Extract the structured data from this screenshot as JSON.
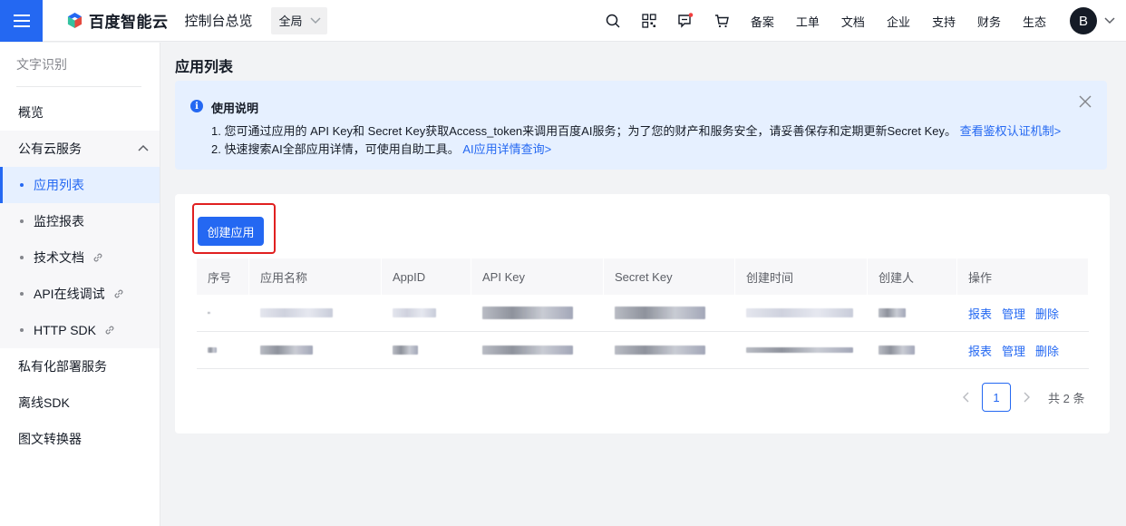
{
  "topbar": {
    "brand": "百度智能云",
    "console_title": "控制台总览",
    "region": "全局",
    "nav": [
      "备案",
      "工单",
      "文档",
      "企业",
      "支持",
      "财务",
      "生态"
    ],
    "avatar_letter": "B",
    "icons": [
      "search-icon",
      "qrcode-icon",
      "message-icon",
      "cart-icon"
    ],
    "accent": "#2468f2"
  },
  "sidebar": {
    "header": "文字识别",
    "overview": "概览",
    "public_group": "公有云服务",
    "sub_items": [
      "应用列表",
      "监控报表",
      "技术文档",
      "API在线调试",
      "HTTP SDK"
    ],
    "private_deploy": "私有化部署服务",
    "offline_sdk": "离线SDK",
    "converter": "图文转换器"
  },
  "main": {
    "title": "应用列表",
    "notice": {
      "title": "使用说明",
      "line1": "1. 您可通过应用的 API Key和 Secret Key获取Access_token来调用百度AI服务；为了您的财产和服务安全，请妥善保存和定期更新Secret Key。",
      "line1_link": "查看鉴权认证机制>",
      "line2": "2. 快速搜索AI全部应用详情，可使用自助工具。",
      "line2_link": "AI应用详情查询>"
    },
    "create_button": "创建应用",
    "table": {
      "headers": [
        "序号",
        "应用名称",
        "AppID",
        "API Key",
        "Secret Key",
        "创建时间",
        "创建人",
        "操作"
      ],
      "row_actions": [
        "报表",
        "管理",
        "删除"
      ],
      "row_count": 2
    },
    "pagination": {
      "current_page": "1",
      "total": "共 2 条"
    }
  }
}
